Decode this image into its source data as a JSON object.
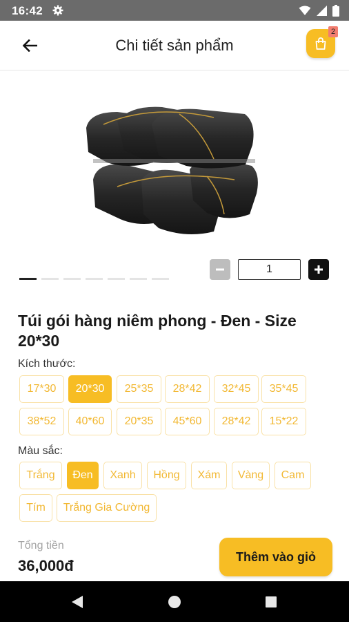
{
  "status_bar": {
    "time": "16:42",
    "icons": [
      "settings-gear-icon",
      "wifi-icon",
      "signal-icon",
      "battery-icon"
    ]
  },
  "header": {
    "title": "Chi tiết sản phẩm",
    "back_icon": "arrow-left-icon",
    "cart_icon": "shopping-bag-icon",
    "cart_count": "2"
  },
  "gallery": {
    "image_alt": "black-plastic-packaging-bags",
    "dot_count": 7,
    "active_index": 0
  },
  "quantity": {
    "value": "1",
    "minus_icon": "minus-icon",
    "plus_icon": "plus-icon"
  },
  "product": {
    "name": "Túi gói hàng niêm phong - Đen - Size 20*30"
  },
  "sizes": {
    "label": "Kích thước:",
    "selected": "20*30",
    "options": [
      "17*30",
      "20*30",
      "25*35",
      "28*42",
      "32*45",
      "35*45",
      "38*52",
      "40*60",
      "20*35",
      "45*60",
      "28*42",
      "15*22"
    ]
  },
  "colors": {
    "label": "Màu sắc:",
    "selected": "Đen",
    "options": [
      "Trắng",
      "Đen",
      "Xanh",
      "Hồng",
      "Xám",
      "Vàng",
      "Cam",
      "Tím",
      "Trắng Gia Cường"
    ]
  },
  "footer": {
    "total_label": "Tổng tiền",
    "total_value": "36,000đ",
    "add_to_cart": "Thêm vào giỏ"
  },
  "theme": {
    "accent": "#f7bd24",
    "chip_border": "#f9e1a6",
    "chip_text": "#f2b833",
    "badge": "#f27d6f"
  },
  "nav_bar": {
    "icons": [
      "nav-back-icon",
      "nav-home-icon",
      "nav-recents-icon"
    ]
  }
}
